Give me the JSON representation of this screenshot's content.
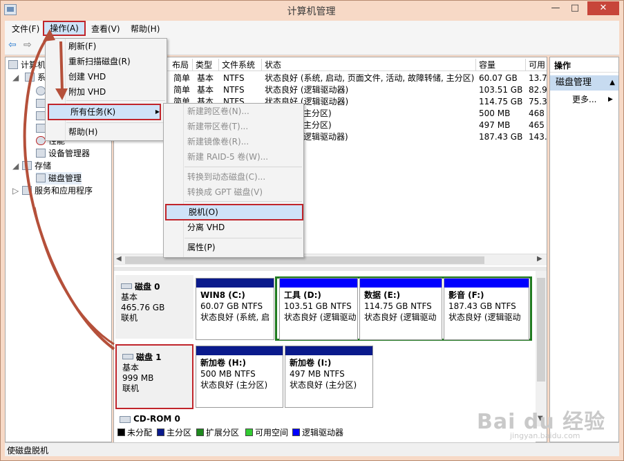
{
  "window": {
    "title": "计算机管理",
    "min_glyph": "—",
    "max_glyph": "□",
    "close_glyph": "✕"
  },
  "menubar": {
    "file": "文件(F)",
    "action": "操作(A)",
    "view": "查看(V)",
    "help": "帮助(H)"
  },
  "toolbar": {
    "back_glyph": "⇦",
    "forward_glyph": "⇨"
  },
  "tree": {
    "root": "计算机",
    "system_tools": "系",
    "item_device_manager": "设备管理器",
    "item_storage": "存储",
    "item_disk_management": "磁盘管理",
    "item_services": "服务和应用程序",
    "fragment": "性能"
  },
  "volume_table": {
    "headers": [
      "布局",
      "类型",
      "文件系统",
      "状态",
      "容量",
      "可用"
    ],
    "rows": [
      [
        "简单",
        "基本",
        "NTFS",
        "状态良好 (系统, 启动, 页面文件, 活动, 故障转储, 主分区)",
        "60.07 GB",
        "13.7"
      ],
      [
        "简单",
        "基本",
        "NTFS",
        "状态良好 (逻辑驱动器)",
        "103.51 GB",
        "82.9"
      ],
      [
        "简单",
        "基本",
        "NTFS",
        "状态良好 (逻辑驱动器)",
        "114.75 GB",
        "75.3"
      ],
      [
        "",
        "",
        "",
        "主分区)",
        "500 MB",
        "468"
      ],
      [
        "",
        "",
        "",
        "主分区)",
        "497 MB",
        "465"
      ],
      [
        "",
        "",
        "",
        "逻辑驱动器)",
        "187.43 GB",
        "143."
      ]
    ]
  },
  "disks": {
    "disk0": {
      "name": "磁盘 0",
      "type": "基本",
      "size": "465.76 GB",
      "status": "联机",
      "partitions": [
        {
          "name": "WIN8 (C:)",
          "size": "60.07 GB NTFS",
          "status": "状态良好 (系统, 启",
          "color": "#0a1a8c"
        },
        {
          "name": "工具 (D:)",
          "size": "103.51 GB NTFS",
          "status": "状态良好 (逻辑驱动",
          "color": "#0000ff"
        },
        {
          "name": "数据 (E:)",
          "size": "114.75 GB NTFS",
          "status": "状态良好 (逻辑驱动",
          "color": "#0000ff"
        },
        {
          "name": "影音 (F:)",
          "size": "187.43 GB NTFS",
          "status": "状态良好 (逻辑驱动",
          "color": "#0000ff"
        }
      ]
    },
    "disk1": {
      "name": "磁盘 1",
      "type": "基本",
      "size": "999 MB",
      "status": "联机",
      "partitions": [
        {
          "name": "新加卷 (H:)",
          "size": "500 MB NTFS",
          "status": "状态良好 (主分区)",
          "color": "#0a1a8c"
        },
        {
          "name": "新加卷 (I:)",
          "size": "497 MB NTFS",
          "status": "状态良好 (主分区)",
          "color": "#0a1a8c"
        }
      ]
    },
    "cdrom": {
      "name": "CD-ROM 0"
    }
  },
  "legend": [
    {
      "label": "未分配",
      "color": "#000000"
    },
    {
      "label": "主分区",
      "color": "#0a1a8c"
    },
    {
      "label": "扩展分区",
      "color": "#1f8a1f"
    },
    {
      "label": "可用空间",
      "color": "#33cc33"
    },
    {
      "label": "逻辑驱动器",
      "color": "#0000ff"
    }
  ],
  "actions_pane": {
    "header": "操作",
    "section": "磁盘管理",
    "more": "更多...",
    "up_glyph": "▲",
    "more_glyph": "▶"
  },
  "action_menu": {
    "refresh": "刷新(F)",
    "rescan": "重新扫描磁盘(R)",
    "create_vhd": "创建 VHD",
    "attach_vhd": "附加 VHD",
    "all_tasks": "所有任务(K)",
    "help": "帮助(H)",
    "submenu_glyph": "▶"
  },
  "all_tasks_menu": {
    "new_spanned": "新建跨区卷(N)...",
    "new_striped": "新建带区卷(T)...",
    "new_mirrored": "新建镜像卷(R)...",
    "new_raid5": "新建 RAID-5 卷(W)...",
    "convert_dynamic": "转换到动态磁盘(C)...",
    "convert_gpt": "转换成 GPT 磁盘(V)",
    "offline": "脱机(O)",
    "detach_vhd": "分离 VHD",
    "properties": "属性(P)"
  },
  "statusbar": {
    "text": "使磁盘脱机"
  },
  "watermark": {
    "brand": "Bai du 经验",
    "url": "jingyan.baidu.com"
  },
  "colors": {
    "highlight_red": "#c0242a",
    "annotation_arrow": "#b5503a",
    "logical_group_border": "#1f7a1f",
    "menu_highlight": "#cfe3f8"
  }
}
